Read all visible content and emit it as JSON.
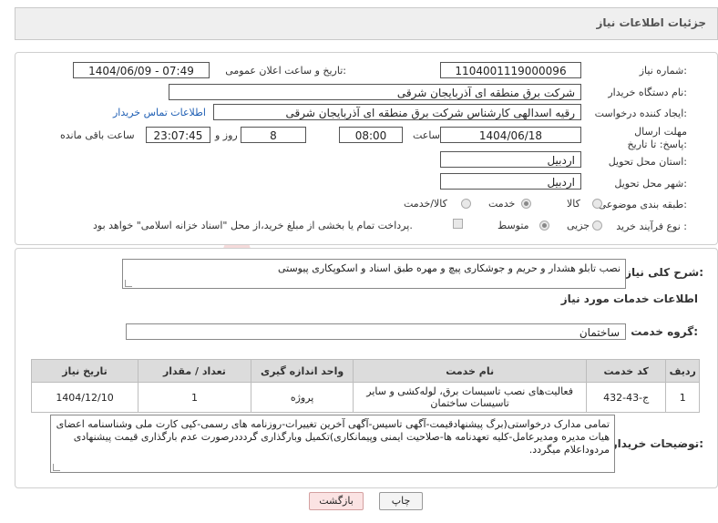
{
  "title": "جزئیات اطلاعات نیاز",
  "fields": {
    "need_number_label": "شماره نیاز:",
    "need_number": "1104001119000096",
    "announce_label": "تاریخ و ساعت اعلان عمومی:",
    "announce_value": "1404/06/09 - 07:49",
    "buyer_org_label": "نام دستگاه خریدار:",
    "buyer_org": "شرکت برق منطقه ای آذربایجان شرقی",
    "requester_label": "ایجاد کننده درخواست:",
    "requester": "رقیه اسدالهی کارشناس شرکت برق منطقه ای آذربایجان شرقی",
    "contact_link": "اطلاعات تماس خریدار",
    "deadline_label": "مهلت ارسال پاسخ: تا تاریخ:",
    "deadline_date": "1404/06/18",
    "time_label": "ساعت",
    "deadline_time": "08:00",
    "days_value": "8",
    "days_label": "روز و",
    "remaining_time": "23:07:45",
    "remaining_label": "ساعت باقی مانده",
    "province_label": "استان محل تحویل:",
    "province": "اردبیل",
    "city_label": "شهر محل تحویل:",
    "city": "اردبیل",
    "category_label": "طبقه بندی موضوعی:",
    "category_options": [
      "کالا",
      "خدمت",
      "کالا/خدمت"
    ],
    "category_selected": "خدمت",
    "process_label": "نوع فرآیند خرید :",
    "process_options": [
      "جزیی",
      "متوسط"
    ],
    "process_selected": "متوسط",
    "payment_note": "پرداخت تمام یا بخشی از مبلغ خرید،از محل \"اسناد خزانه اسلامی\" خواهد بود."
  },
  "summary": {
    "label": "شرح کلی نیاز:",
    "text": "نصب تابلو هشدار و حریم و جوشکاری پیچ و مهره طبق اسناد و اسکوپکاری پیوستی"
  },
  "services": {
    "heading": "اطلاعات خدمات مورد نیاز",
    "group_label": "گروه خدمت:",
    "group_value": "ساختمان",
    "columns": [
      "ردیف",
      "کد خدمت",
      "نام خدمت",
      "واحد اندازه گیری",
      "تعداد / مقدار",
      "تاریخ نیاز"
    ],
    "rows": [
      [
        "1",
        "ج-43-432",
        "فعالیت‌های نصب تاسیسات برق، لوله‌کشی و سایر تاسیسات ساختمان",
        "پروژه",
        "1",
        "1404/12/10"
      ]
    ]
  },
  "buyer_notes": {
    "label": "توضیحات خریدار:",
    "text": "تمامی مدارک درخواستی(برگ پیشنهادقیمت-آگهی تاسیس-آگهی آخرین تغییرات-روزنامه های رسمی-کپی کارت ملی وشناسنامه اعضای هیات مدیره ومدیرعامل-کلیه تعهدنامه ها-صلاحیت ایمنی وپیمانکاری)تکمیل وبارگذاری گردددرصورت عدم بارگذاری قیمت پیشنهادی مردوداعلام میگردد."
  },
  "buttons": {
    "print": "چاپ",
    "back": "بازگشت"
  },
  "watermark_text": "AriaTender.net",
  "colors": {
    "accent_red": "#c94040",
    "link": "#1f5fb4",
    "back_btn_bg": "#fbe3e3"
  }
}
